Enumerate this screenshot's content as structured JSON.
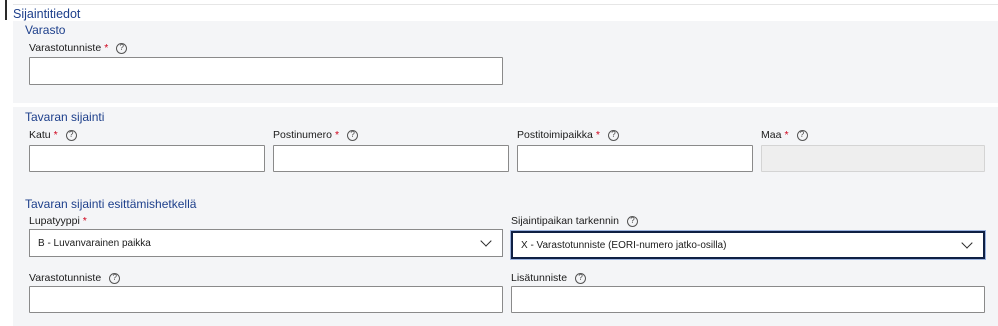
{
  "section": {
    "title": "Sijaintitiedot"
  },
  "varasto": {
    "title": "Varasto",
    "fields": {
      "varastotunniste": {
        "label": "Varastotunniste",
        "required": "*",
        "help": "?",
        "value": ""
      }
    }
  },
  "tavaran_sijainti": {
    "title": "Tavaran sijainti",
    "fields": {
      "katu": {
        "label": "Katu",
        "required": "*",
        "help": "?",
        "value": ""
      },
      "postinumero": {
        "label": "Postinumero",
        "required": "*",
        "help": "?",
        "value": ""
      },
      "postitoimipaikka": {
        "label": "Postitoimipaikka",
        "required": "*",
        "help": "?",
        "value": ""
      },
      "maa": {
        "label": "Maa",
        "required": "*",
        "help": "?",
        "value": ""
      }
    }
  },
  "esittamishetki": {
    "title": "Tavaran sijainti esittämishetkellä",
    "fields": {
      "lupatyyppi": {
        "label": "Lupatyyppi",
        "required": "*",
        "value": "B - Luvanvarainen paikka"
      },
      "sijaintipaikan_tarkennin": {
        "label": "Sijaintipaikan tarkennin",
        "help": "?",
        "value": "X - Varastotunniste (EORI-numero jatko-osilla)"
      },
      "varastotunniste": {
        "label": "Varastotunniste",
        "help": "?",
        "value": ""
      },
      "lisatunniste": {
        "label": "Lisätunniste",
        "help": "?",
        "value": ""
      }
    }
  }
}
